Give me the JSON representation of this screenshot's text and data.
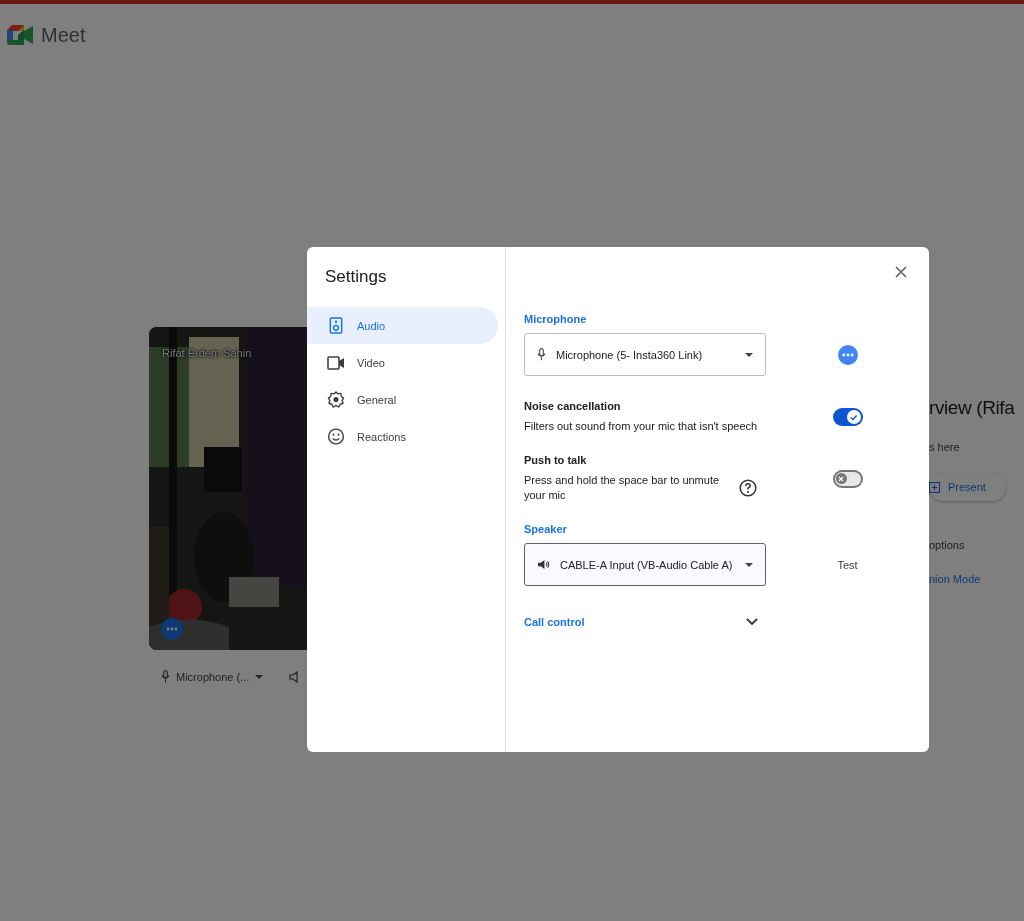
{
  "topbar": {
    "app_name": "Meet"
  },
  "preview": {
    "name": "Rifat Erdem Sahin",
    "mic_label": "Microphone (..."
  },
  "side_panel": {
    "heading": "rview (Rifa",
    "subtext": "s here",
    "present_button": "Present",
    "options_label": "options",
    "mode_link": "nion Mode"
  },
  "dialog": {
    "title": "Settings",
    "nav": [
      {
        "label": "Audio",
        "selected": true
      },
      {
        "label": "Video",
        "selected": false
      },
      {
        "label": "General",
        "selected": false
      },
      {
        "label": "Reactions",
        "selected": false
      }
    ],
    "microphone": {
      "label": "Microphone",
      "value": "Microphone (5- Insta360 Link)"
    },
    "noise_cancellation": {
      "title": "Noise cancellation",
      "description": "Filters out sound from your mic that isn't speech",
      "on": true
    },
    "push_to_talk": {
      "title": "Push to talk",
      "description": "Press and hold the space bar to unmute your mic",
      "on": false
    },
    "speaker": {
      "label": "Speaker",
      "value": "CABLE-A Input (VB-Audio Cable A)",
      "test_button": "Test"
    },
    "call_control": {
      "label": "Call control",
      "expanded": false
    }
  }
}
